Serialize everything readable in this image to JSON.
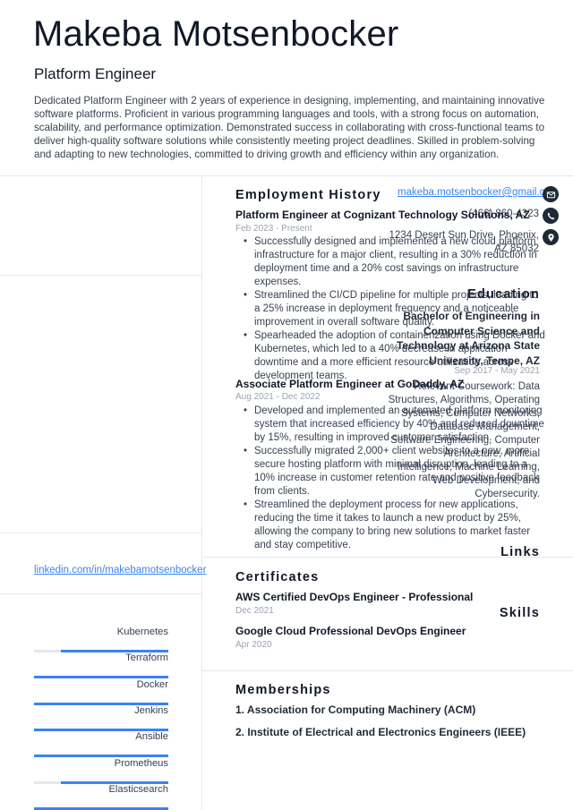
{
  "header": {
    "name": "Makeba Motsenbocker",
    "job_title": "Platform Engineer",
    "summary": "Dedicated Platform Engineer with 2 years of experience in designing, implementing, and maintaining innovative software platforms. Proficient in various programming languages and tools, with a strong focus on automation, scalability, and performance optimization. Demonstrated success in collaborating with cross-functional teams to deliver high-quality software solutions while consistently meeting project deadlines. Skilled in problem-solving and adapting to new technologies, committed to driving growth and efficiency within any organization."
  },
  "contact": {
    "email": "makeba.motsenbocker@gmail.com",
    "email_visible": "makeba.motsenbocker@gmail.co",
    "phone": "(466) 860-4323",
    "address_line1": "1234 Desert Sun Drive, Phoenix,",
    "address_line2": "AZ 85032",
    "icons": [
      "envelope-icon",
      "phone-icon",
      "map-pin-icon"
    ]
  },
  "education": {
    "heading": "Education",
    "degree": "Bachelor of Engineering in Computer Science and Technology at Arizona State University, Tempe, AZ",
    "dates": "Sep 2017 - May 2021",
    "description": "Relevant Coursework: Data Structures, Algorithms, Operating Systems, Computer Networks, Database Management, Software Engineering, Computer Architecture, Artificial Intelligence, Machine Learning, Web Development, and Cybersecurity."
  },
  "links": {
    "heading": "Links",
    "items": [
      {
        "label": "linkedin.com/in/makebamotsenbocker"
      }
    ]
  },
  "skills": {
    "heading": "Skills",
    "items": [
      {
        "name": "Kubernetes",
        "level": 0.8
      },
      {
        "name": "Terraform",
        "level": 1.0
      },
      {
        "name": "Docker",
        "level": 1.0
      },
      {
        "name": "Jenkins",
        "level": 1.0
      },
      {
        "name": "Ansible",
        "level": 1.0
      },
      {
        "name": "Prometheus",
        "level": 0.8
      },
      {
        "name": "Elasticsearch",
        "level": 1.0
      }
    ]
  },
  "employment": {
    "heading": "Employment History",
    "jobs": [
      {
        "title": "Platform Engineer at Cognizant Technology Solutions, AZ",
        "dates": "Feb 2023 - Present",
        "bullets": [
          "Successfully designed and implemented a new cloud platform infrastructure for a major client, resulting in a 30% reduction in deployment time and a 20% cost savings on infrastructure expenses.",
          "Streamlined the CI/CD pipeline for multiple projects, leading to a 25% increase in deployment frequency and a noticeable improvement in overall software quality.",
          "Spearheaded the adoption of containerization using Docker and Kubernetes, which led to a 40% decrease in application downtime and a more efficient resource utilization across development teams."
        ]
      },
      {
        "title": "Associate Platform Engineer at GoDaddy, AZ",
        "dates": "Aug 2021 - Dec 2022",
        "bullets": [
          "Developed and implemented an automated platform monitoring system that increased efficiency by 40% and reduced downtime by 15%, resulting in improved customer satisfaction.",
          "Successfully migrated 2,000+ client websites to a new, more secure hosting platform with minimal disruption, leading to a 10% increase in customer retention rate and positive feedback from clients.",
          "Streamlined the deployment process for new applications, reducing the time it takes to launch a new product by 25%, allowing the company to bring new solutions to market faster and stay competitive."
        ]
      }
    ]
  },
  "certificates": {
    "heading": "Certificates",
    "items": [
      {
        "name": "AWS Certified DevOps Engineer - Professional",
        "date": "Dec 2021"
      },
      {
        "name": "Google Cloud Professional DevOps Engineer",
        "date": "Apr 2020"
      }
    ]
  },
  "memberships": {
    "heading": "Memberships",
    "items": [
      "1. Association for Computing Machinery (ACM)",
      "2. Institute of Electrical and Electronics Engineers (IEEE)"
    ]
  },
  "colors": {
    "accent": "#3b82f6",
    "text_dark": "#111827",
    "muted": "#9ca3af",
    "divider": "#e5e7eb"
  }
}
